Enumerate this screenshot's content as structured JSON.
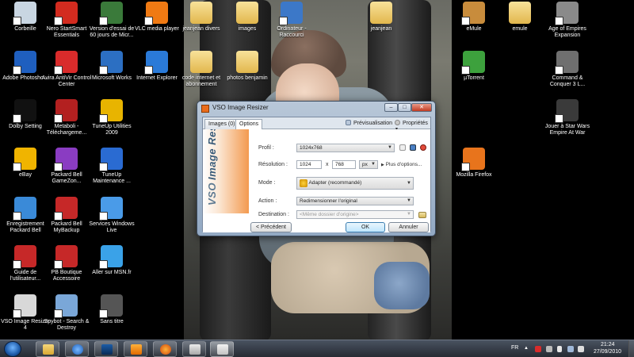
{
  "desktop": {
    "icons": [
      {
        "label": "Corbeille",
        "icon": "recycle-bin-icon",
        "color": "#c9d6e2"
      },
      {
        "label": "Nero StartSmart Essentials",
        "icon": "nero-icon",
        "color": "#d32b1f"
      },
      {
        "label": "Version d'essai de 60 jours de Micr...",
        "icon": "office-trial-icon",
        "color": "#3a7a3a"
      },
      {
        "label": "VLC media player",
        "icon": "vlc-cone-icon",
        "color": "#f07a13"
      },
      {
        "label": "Adobe Photosho...",
        "icon": "photoshop-icon",
        "color": "#1f5fbf"
      },
      {
        "label": "Avira AntiVir Control Center",
        "icon": "avira-icon",
        "color": "#d92b2b"
      },
      {
        "label": "Microsoft Works",
        "icon": "works-icon",
        "color": "#2c6fc2"
      },
      {
        "label": "Internet Explorer",
        "icon": "internet-explorer-icon",
        "color": "#2a7ad8"
      },
      {
        "label": "Dolby Setting",
        "icon": "dolby-icon",
        "color": "#111111"
      },
      {
        "label": "Metaboli - Téléchargeme...",
        "icon": "metaboli-icon",
        "color": "#b32020"
      },
      {
        "label": "TuneUp Utilities 2009",
        "icon": "tuneup-icon",
        "color": "#e8b400"
      },
      {
        "label": "eBay",
        "icon": "ebay-icon",
        "color": "#f0b400"
      },
      {
        "label": "Packard Bell GameZon...",
        "icon": "gamezone-icon",
        "color": "#8a3cc2"
      },
      {
        "label": "TuneUp Maintenance ...",
        "icon": "tuneup-maintenance-icon",
        "color": "#2a6bd2"
      },
      {
        "label": "Enregistrement Packard Bell",
        "icon": "registration-globe-icon",
        "color": "#3a8ad8"
      },
      {
        "label": "Packard Bell MyBackup",
        "icon": "mybackup-icon",
        "color": "#c62828"
      },
      {
        "label": "Services Windows Live",
        "icon": "windows-live-icon",
        "color": "#4a9be8"
      },
      {
        "label": "Guide de l'utilisateur...",
        "icon": "help-guide-icon",
        "color": "#c62828"
      },
      {
        "label": "PB Boutique Accessoire",
        "icon": "pb-boutique-icon",
        "color": "#c62828"
      },
      {
        "label": "Aller sur MSN.fr",
        "icon": "msn-butterfly-icon",
        "color": "#3aa2e8"
      },
      {
        "label": "VSO Image Resizer 4",
        "icon": "vso-image-resizer-icon",
        "color": "#d8d8d8"
      },
      {
        "label": "Spybot - Search & Destroy",
        "icon": "spybot-icon",
        "color": "#7aa7d8"
      },
      {
        "label": "Sans titre",
        "icon": "image-file-icon",
        "color": "#555555"
      },
      {
        "label": "jeanjean divers",
        "icon": "folder-icon",
        "color": "#e9c25a"
      },
      {
        "label": "images",
        "icon": "folder-icon",
        "color": "#e9c25a"
      },
      {
        "label": "Ordinateur - Raccourci",
        "icon": "computer-icon",
        "color": "#3c78c8"
      },
      {
        "label": "jeanjean",
        "icon": "folder-icon",
        "color": "#e9c25a"
      },
      {
        "label": "code internet et abonnement",
        "icon": "folder-icon",
        "color": "#e9c25a"
      },
      {
        "label": "photos benjamin",
        "icon": "folder-icon",
        "color": "#e9c25a"
      },
      {
        "label": "eMule",
        "icon": "emule-mule-icon",
        "color": "#c88c3c"
      },
      {
        "label": "emule",
        "icon": "folder-icon",
        "color": "#e9c25a"
      },
      {
        "label": "Age of Empires Expansion",
        "icon": "age-of-empires-icon",
        "color": "#8a8a8a"
      },
      {
        "label": "µTorrent",
        "icon": "utorrent-icon",
        "color": "#3da13d"
      },
      {
        "label": "Command & Conquer 3 L...",
        "icon": "command-conquer-icon",
        "color": "#6f6f6f"
      },
      {
        "label": "Jouer à Star Wars Empire At War",
        "icon": "star-wars-icon",
        "color": "#3a3a3a"
      },
      {
        "label": "Mozilla Firefox",
        "icon": "firefox-icon",
        "color": "#e8741c"
      }
    ]
  },
  "dialog": {
    "title": "VSO Image Resizer",
    "tabs": [
      "Images (0)",
      "Options"
    ],
    "preview_link": "Prévisualisation",
    "properties_link": "Propriétés",
    "banner_text": "Image Resizer",
    "banner_logo": "VSO",
    "fields": {
      "profile_label": "Profil :",
      "profile_value": "1024x768",
      "resolution_label": "Résolution :",
      "width": "1024",
      "times": "x",
      "height": "768",
      "unit": "px",
      "more_options": "Plus d'options...",
      "mode_label": "Mode :",
      "mode_value": "Adapter (recommandé)",
      "action_label": "Action :",
      "action_value": "Redimensionner l'original",
      "destination_label": "Destination :",
      "destination_placeholder": "<Même dossier d'origine>"
    },
    "buttons": {
      "previous": "< Précédent",
      "ok": "OK",
      "cancel": "Annuler"
    }
  },
  "taskbar": {
    "language": "FR",
    "time": "21:24",
    "date": "27/09/2010"
  }
}
